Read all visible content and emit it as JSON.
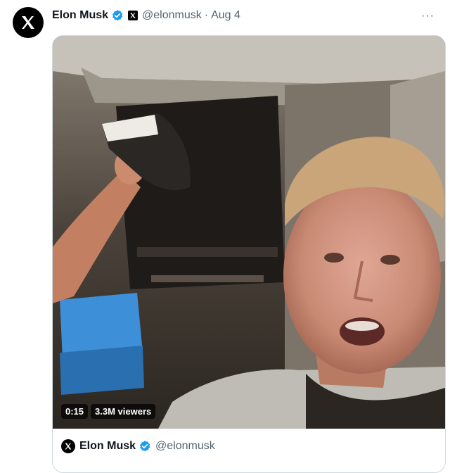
{
  "post": {
    "author_name": "Elon Musk",
    "handle": "@elonmusk",
    "separator": "·",
    "date": "Aug 4",
    "more_label": "···",
    "avatar_icon": "x-logo-icon",
    "verified_color": "#1d9bf0"
  },
  "video": {
    "elapsed": "0:15",
    "viewers": "3.3M viewers"
  },
  "quoted": {
    "author_name": "Elon Musk",
    "handle": "@elonmusk"
  }
}
